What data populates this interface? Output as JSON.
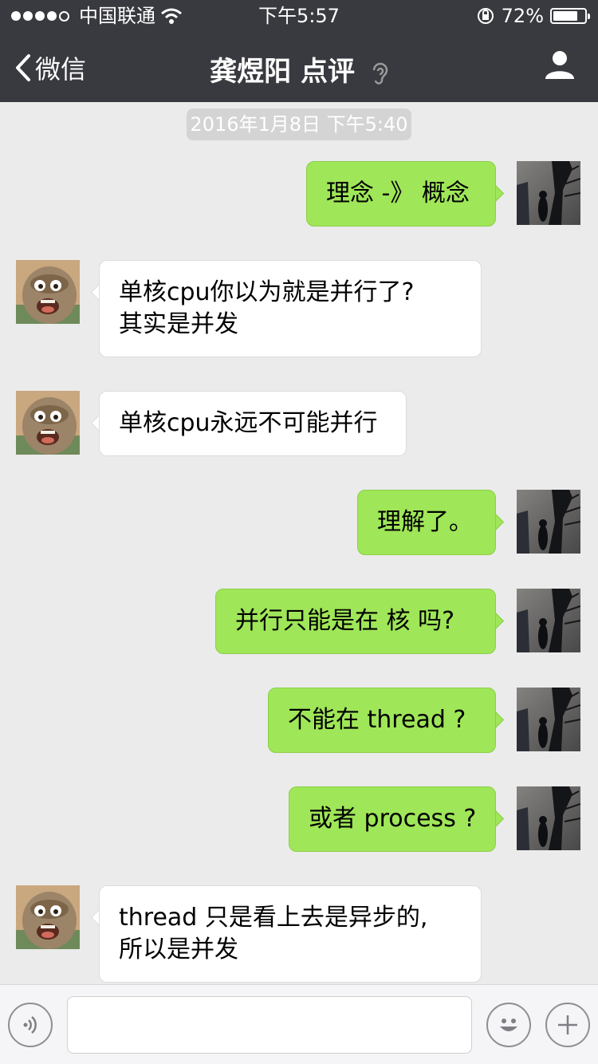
{
  "status": {
    "carrier": "中国联通",
    "time": "下午5:57",
    "battery": "72%",
    "battery_level": 0.72
  },
  "nav": {
    "back_label": "微信",
    "title": "龚煜阳 点评"
  },
  "timestamp": "2016年1月8日 下午5:40",
  "messages": [
    {
      "from": "me",
      "lines": [
        "理念 -》 概念"
      ]
    },
    {
      "from": "them",
      "lines": [
        "单核cpu你以为就是并行了?",
        "其实是并发"
      ]
    },
    {
      "from": "them",
      "lines": [
        "单核cpu永远不可能并行"
      ]
    },
    {
      "from": "me",
      "lines": [
        "理解了。"
      ]
    },
    {
      "from": "me",
      "lines": [
        "并行只能是在 核 吗?"
      ]
    },
    {
      "from": "me",
      "lines": [
        "不能在 thread ?"
      ]
    },
    {
      "from": "me",
      "lines": [
        "或者 process ?"
      ]
    },
    {
      "from": "them",
      "lines": [
        "thread 只是看上去是异步的,",
        "所以是并发"
      ]
    }
  ],
  "colors": {
    "nav_bg": "#393a3f",
    "chat_bg": "#ebebeb",
    "my_bubble": "#9fe658",
    "their_bubble": "#ffffff"
  },
  "icons": {
    "back": "chevron-left-icon",
    "ear": "ear-icon",
    "profile": "person-icon",
    "voice": "voice-icon",
    "emoji": "emoji-icon",
    "plus": "plus-icon"
  }
}
